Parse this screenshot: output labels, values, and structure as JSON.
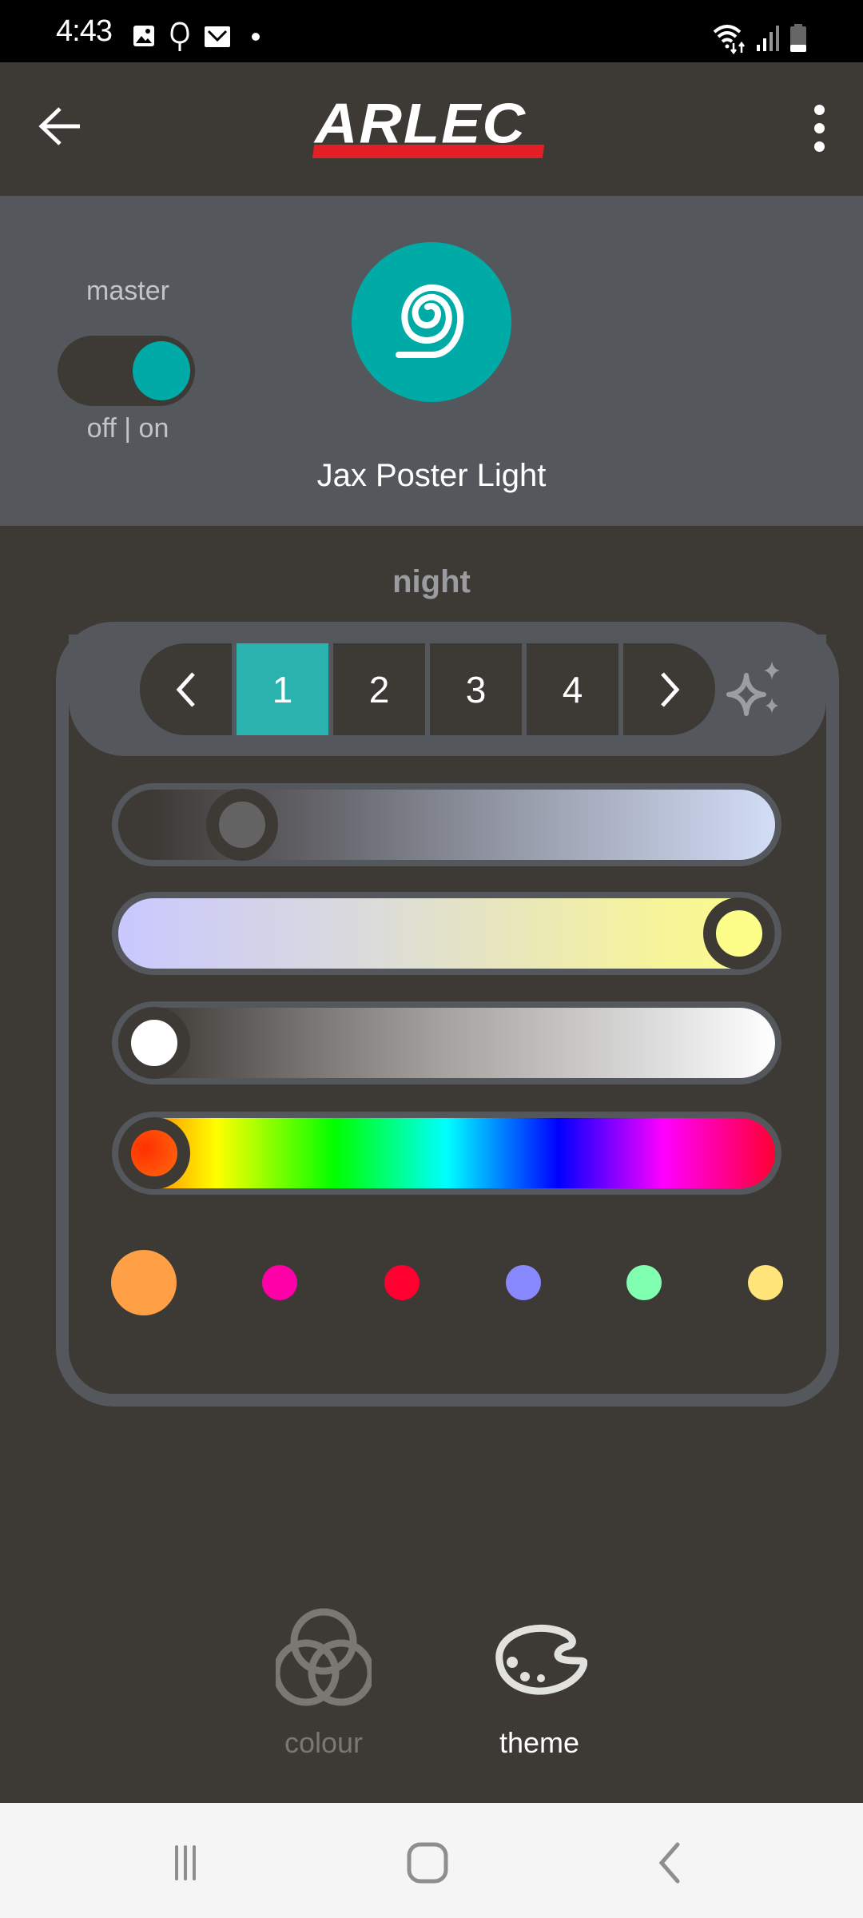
{
  "status_bar": {
    "time": "4:43",
    "left_icons": [
      "gallery-icon",
      "tree-icon",
      "mail-icon",
      "dot-icon"
    ],
    "right_icons": [
      "wifi-icon",
      "signal-icon",
      "battery-icon"
    ]
  },
  "header": {
    "back_icon": "arrow-left-icon",
    "logo_text": "ARLEC",
    "menu_icon": "more-vertical-icon",
    "brand_color": "#e41e26"
  },
  "device": {
    "master_label": "master",
    "toggle_state": "on",
    "toggle_caption": "off | on",
    "icon": "spiral-strip-icon",
    "name": "Jax Poster Light",
    "accent_color": "#00aaa6"
  },
  "theme": {
    "name": "night",
    "pages": [
      {
        "label": "1",
        "active": true
      },
      {
        "label": "2",
        "active": false
      },
      {
        "label": "3",
        "active": false
      },
      {
        "label": "4",
        "active": false
      }
    ],
    "prev_icon": "chevron-left-icon",
    "next_icon": "chevron-right-icon",
    "effects_icon": "sparkles-icon",
    "sliders": [
      {
        "name": "brightness",
        "value_fraction": 0.15
      },
      {
        "name": "temperature",
        "value_fraction": 1.0
      },
      {
        "name": "white",
        "value_fraction": 0.0
      },
      {
        "name": "hue",
        "value_fraction": 0.0
      }
    ],
    "preset_colors": [
      {
        "color": "#ffa047",
        "selected": true
      },
      {
        "color": "#ff00a8",
        "selected": false
      },
      {
        "color": "#ff0030",
        "selected": false
      },
      {
        "color": "#8888ff",
        "selected": false
      },
      {
        "color": "#80ffb0",
        "selected": false
      },
      {
        "color": "#ffe57a",
        "selected": false
      }
    ]
  },
  "tabs": [
    {
      "label": "colour",
      "icon": "color-circles-icon",
      "active": false
    },
    {
      "label": "theme",
      "icon": "palette-icon",
      "active": true
    }
  ],
  "nav_bar": {
    "icons": [
      "recents-icon",
      "home-icon",
      "back-icon"
    ]
  }
}
